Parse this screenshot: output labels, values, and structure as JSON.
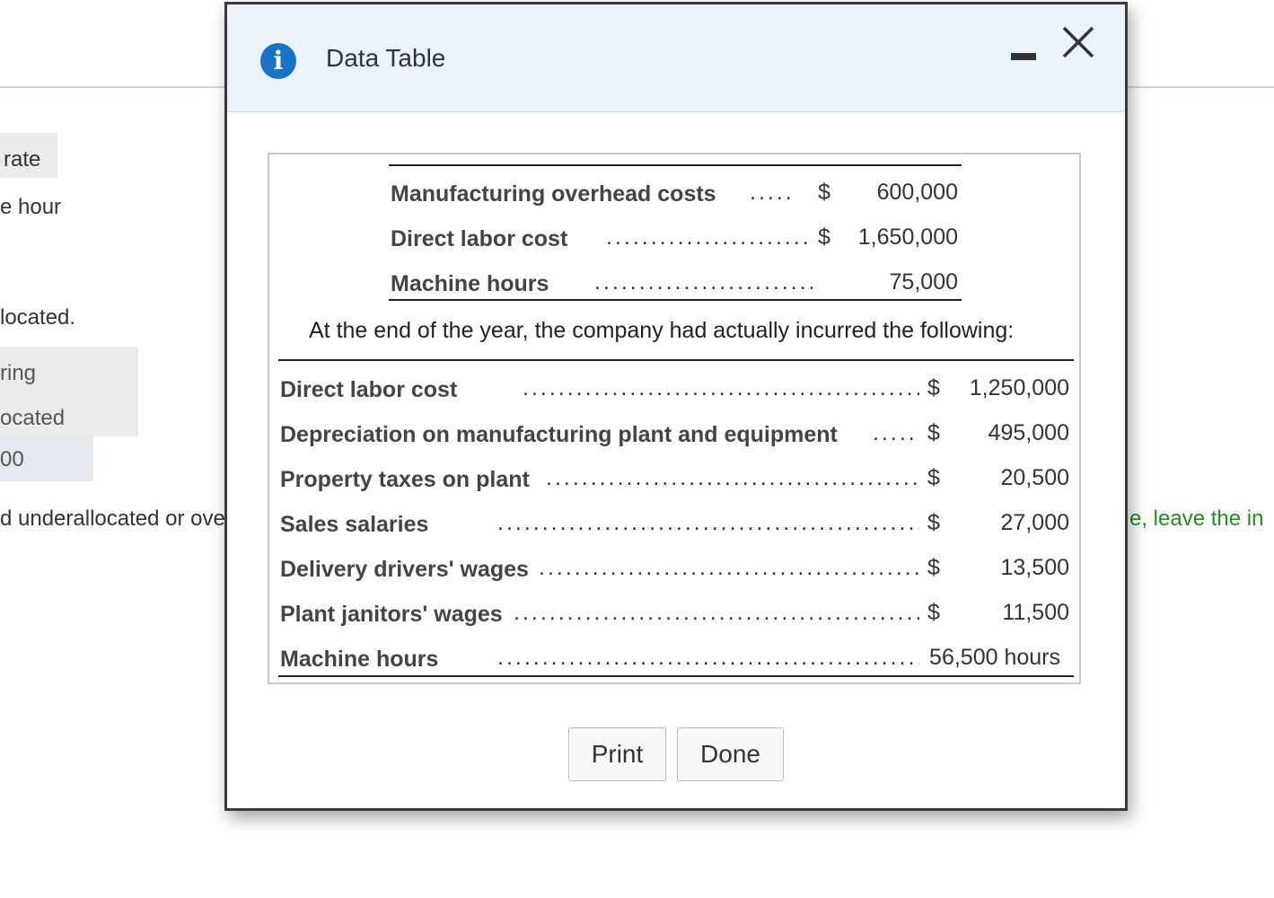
{
  "background": {
    "text_rate": "rate",
    "text_hour": "e hour",
    "text_located": "located.",
    "text_ring": "ring",
    "text_ocated": "ocated",
    "text_00": "00",
    "text_under": "d underallocated or ove",
    "text_leave": "e, leave the in"
  },
  "modal": {
    "title": "Data Table",
    "info_icon_glyph": "i",
    "top_table": [
      {
        "label": "Manufacturing overhead costs",
        "dollar": "$",
        "value": "600,000"
      },
      {
        "label": "Direct labor cost",
        "dollar": "$",
        "value": "1,650,000"
      },
      {
        "label": "Machine hours",
        "dollar": "",
        "value": "75,000"
      }
    ],
    "intro_text": "At the end of the year, the company had actually incurred the following:",
    "actual_table": [
      {
        "label": "Direct labor cost",
        "dollar": "$",
        "value": "1,250,000"
      },
      {
        "label": "Depreciation on manufacturing plant and equipment",
        "dollar": "$",
        "value": "495,000"
      },
      {
        "label": "Property taxes on plant",
        "dollar": "$",
        "value": "20,500"
      },
      {
        "label": "Sales salaries",
        "dollar": "$",
        "value": "27,000"
      },
      {
        "label": "Delivery drivers' wages",
        "dollar": "$",
        "value": "13,500"
      },
      {
        "label": "Plant janitors' wages",
        "dollar": "$",
        "value": "11,500"
      },
      {
        "label": "Machine hours",
        "dollar": "",
        "value": "56,500 hours"
      }
    ],
    "buttons": {
      "print": "Print",
      "done": "Done"
    }
  },
  "colors": {
    "header_bg": "#eaf3fc",
    "info_icon": "#1a73c6",
    "instruction_green": "#228b22"
  }
}
